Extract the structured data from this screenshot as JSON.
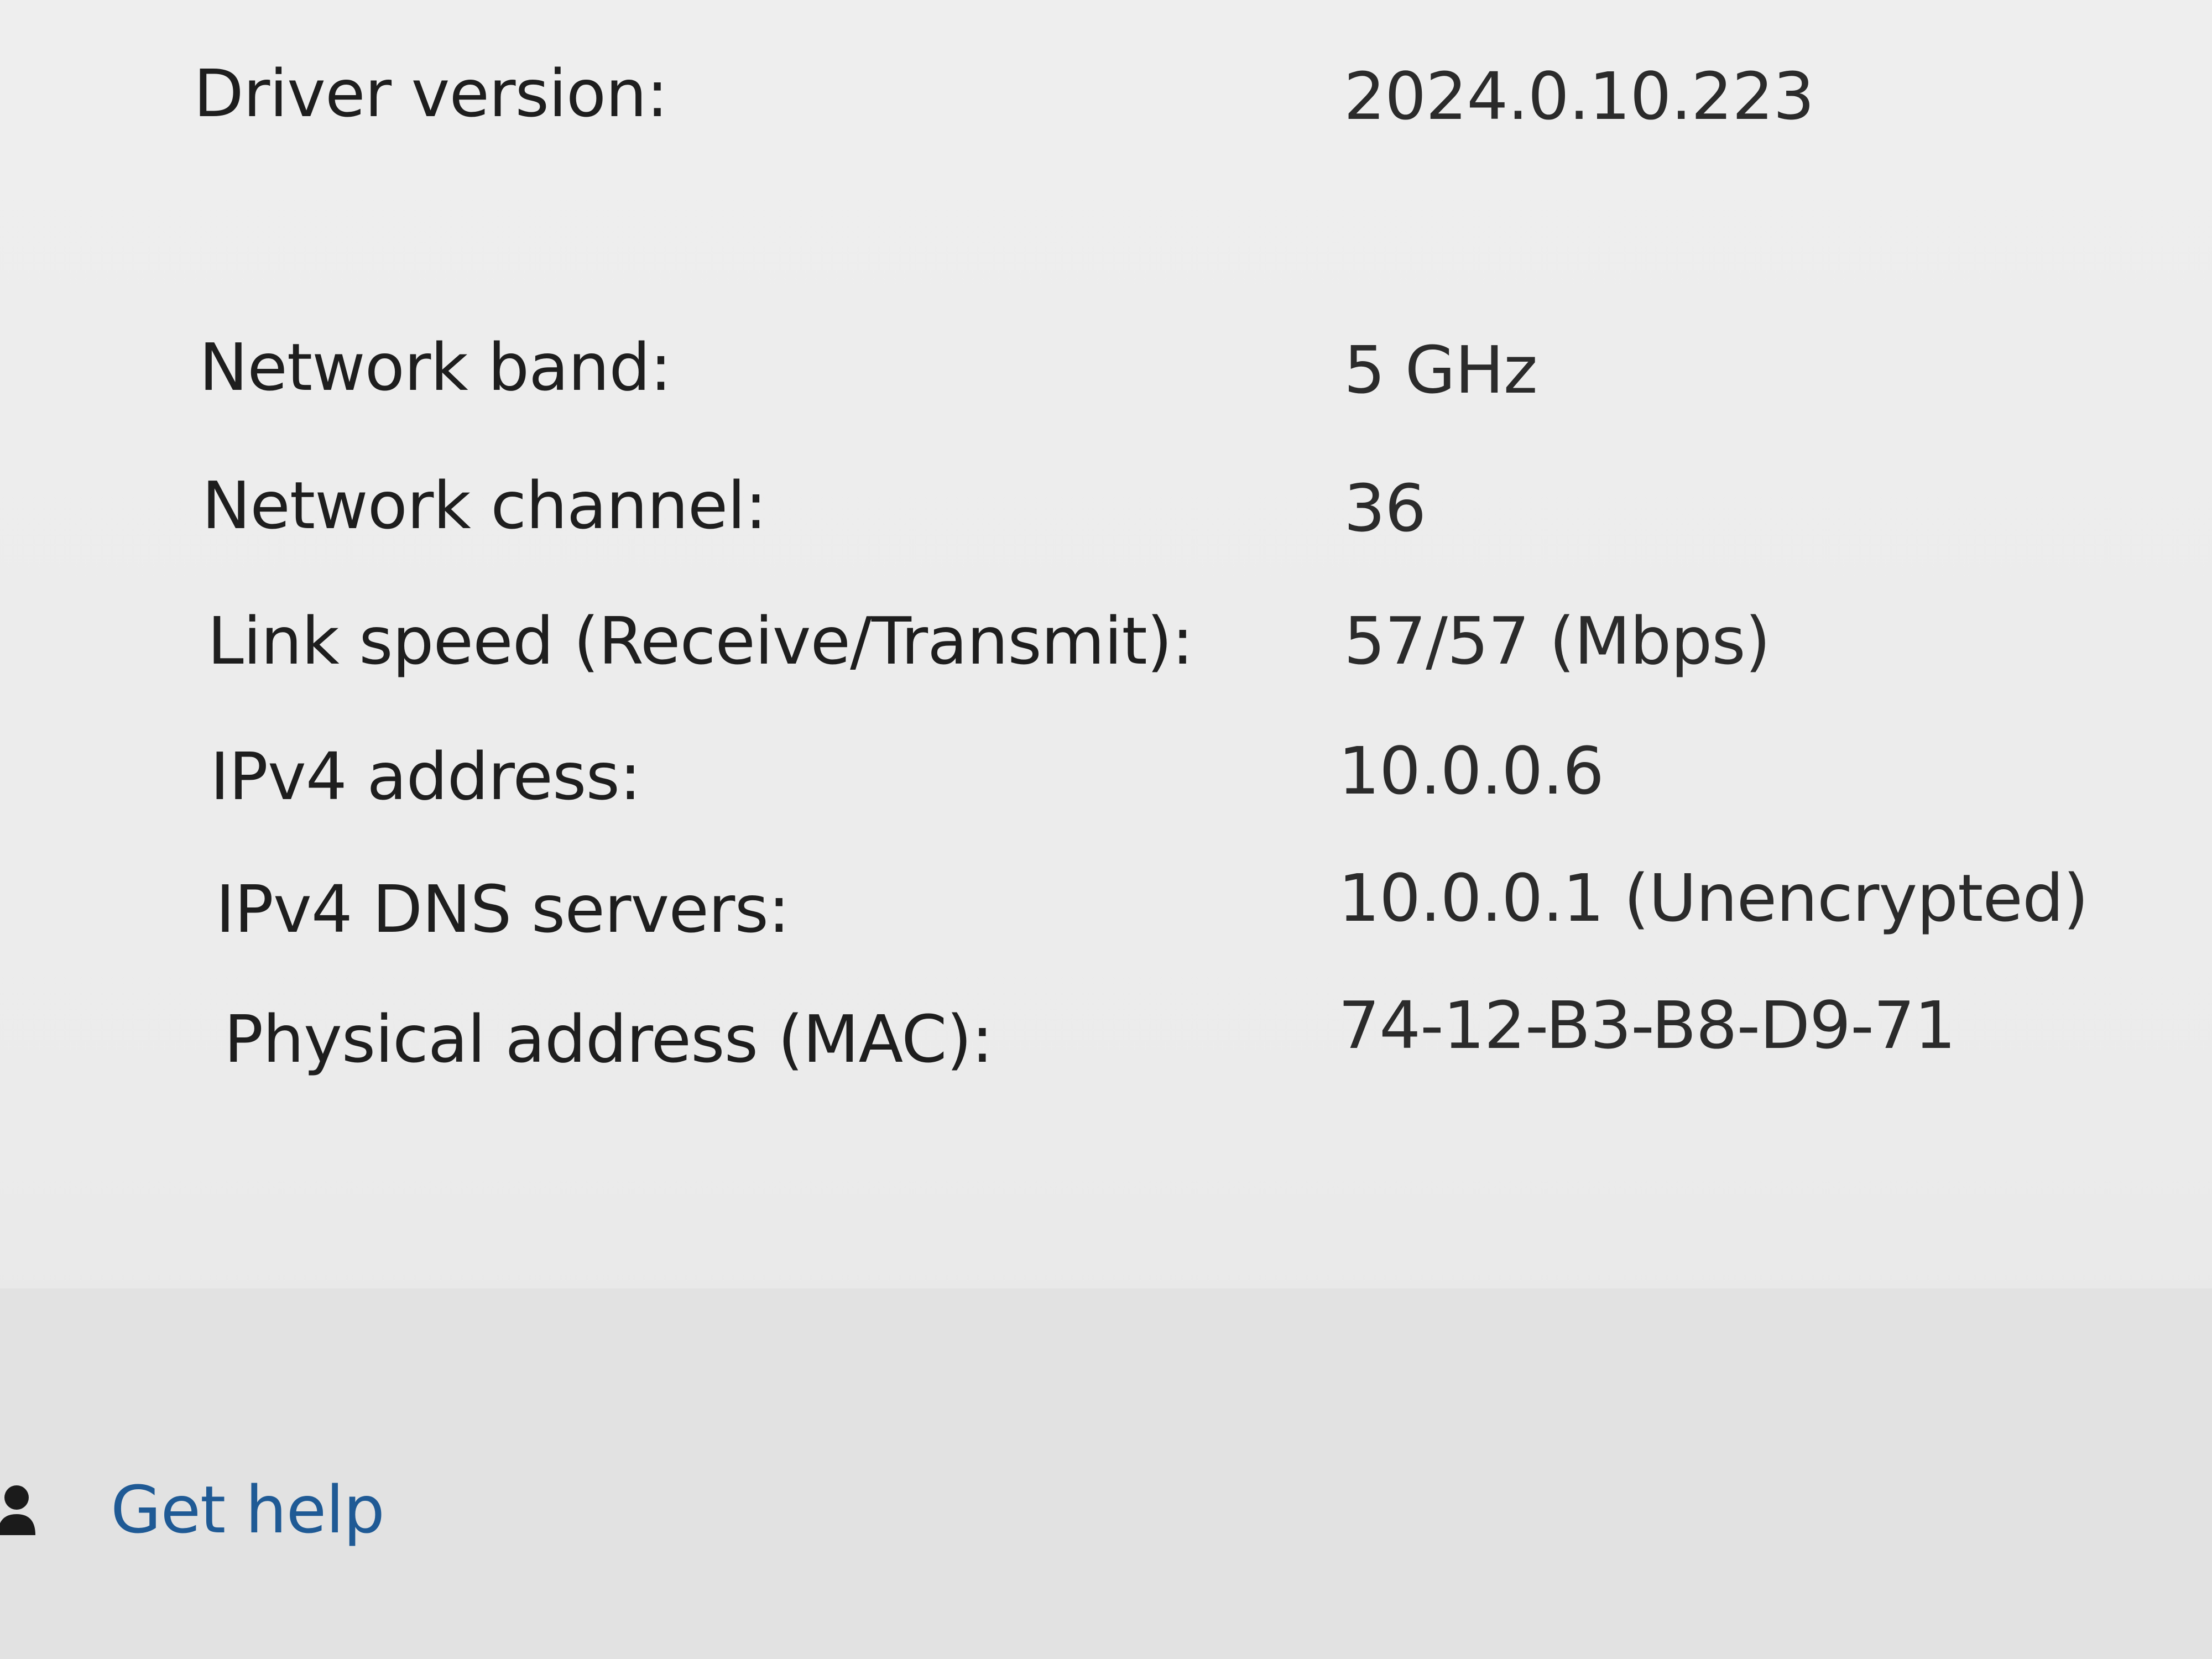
{
  "properties": [
    {
      "label": "Driver version:",
      "value": "2024.0.10.223"
    },
    {
      "label": "Network band:",
      "value": "5 GHz"
    },
    {
      "label": "Network channel:",
      "value": "36"
    },
    {
      "label": "Link speed (Receive/Transmit):",
      "value": "57/57 (Mbps)"
    },
    {
      "label": "IPv4 address:",
      "value": "10.0.0.6"
    },
    {
      "label": "IPv4 DNS servers:",
      "value": "10.0.0.1 (Unencrypted)"
    },
    {
      "label": "Physical address (MAC):",
      "value": "74-12-B3-B8-D9-71"
    }
  ],
  "help": {
    "label": "Get help",
    "icon": "help-person-icon",
    "link_color": "#1f5a95"
  }
}
